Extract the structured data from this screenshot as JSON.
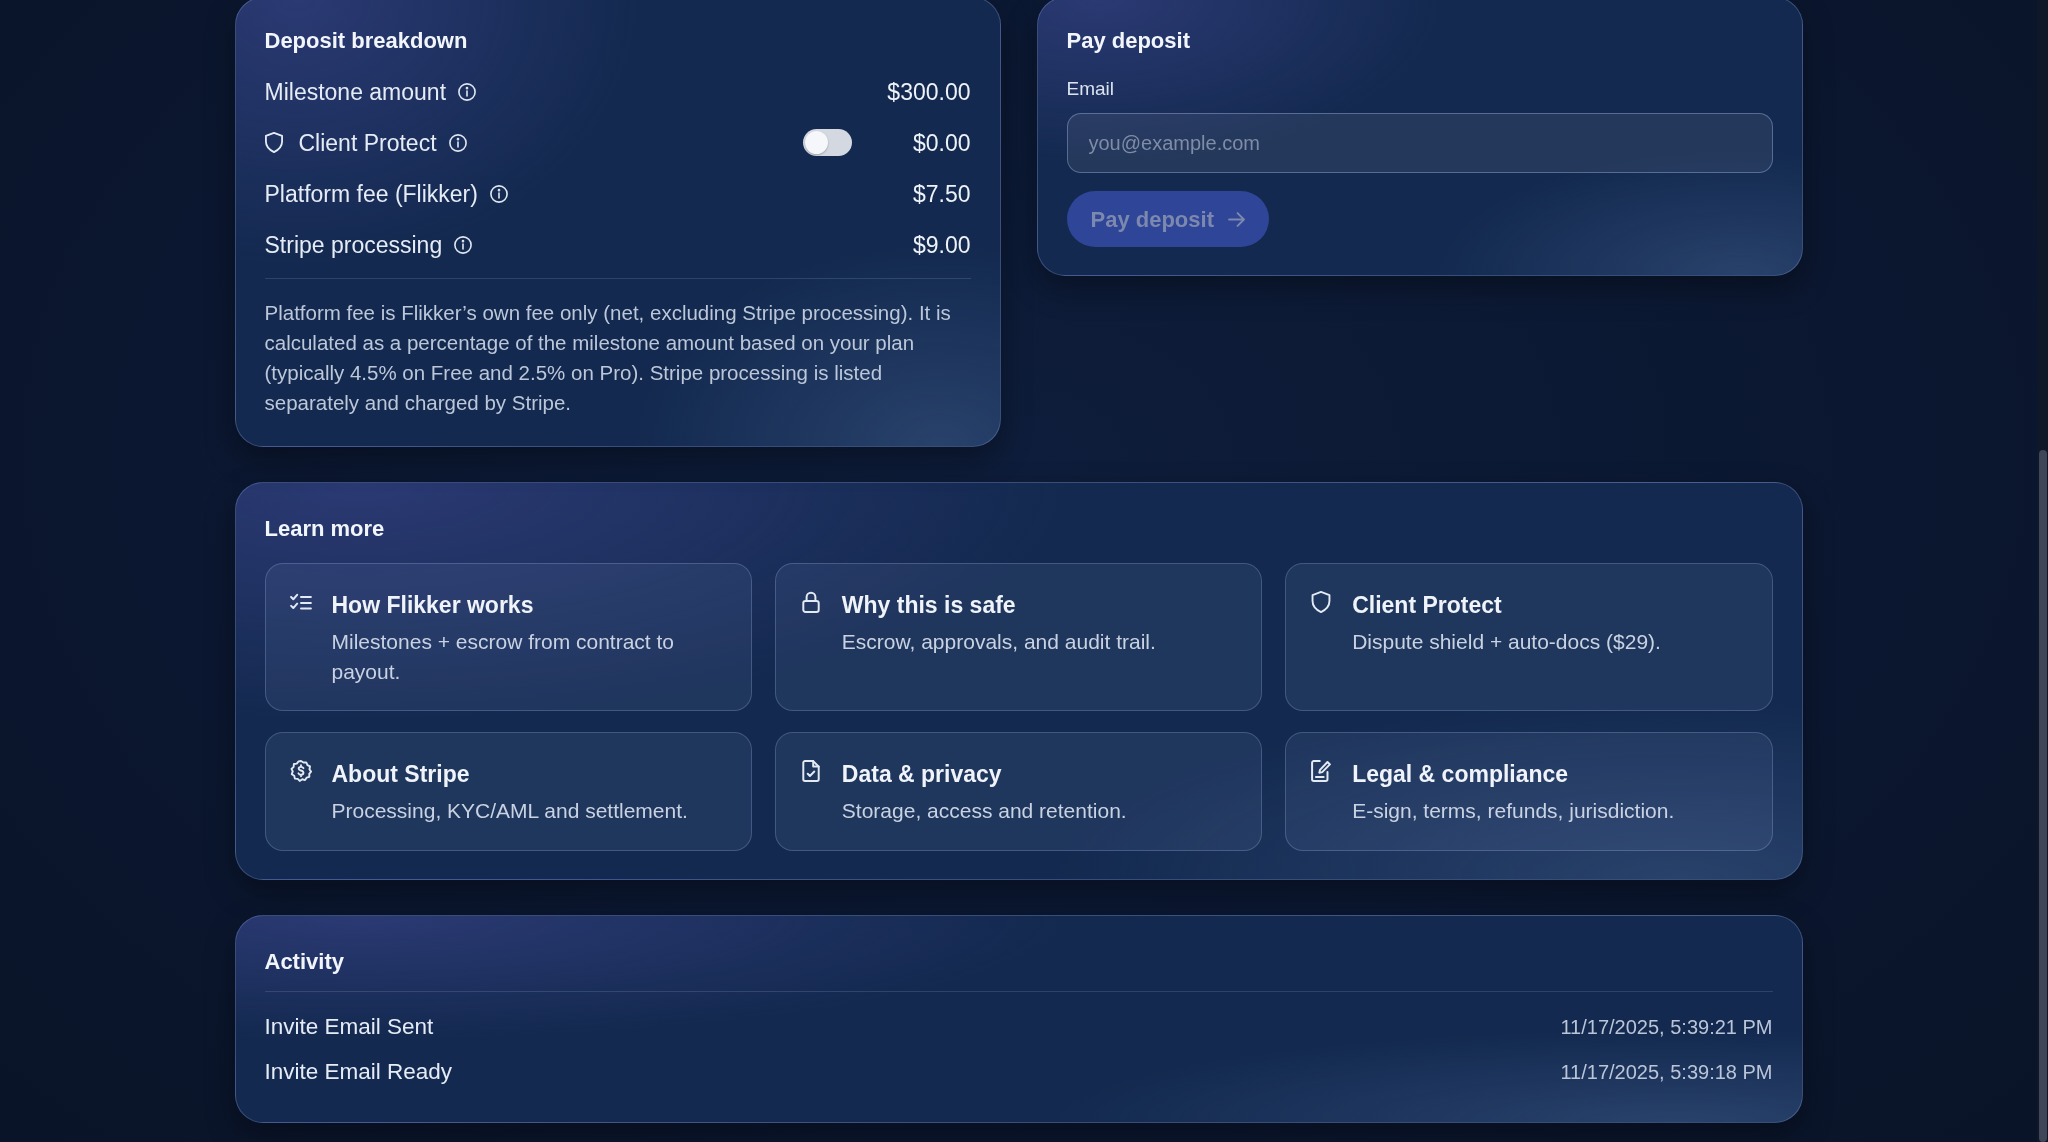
{
  "deposit_breakdown": {
    "title": "Deposit breakdown",
    "rows": [
      {
        "kind": "amount",
        "label": "Milestone amount",
        "amount": "$300.00"
      },
      {
        "kind": "toggle",
        "label": "Client Protect",
        "on": false,
        "amount": "$0.00"
      },
      {
        "kind": "amount",
        "label": "Platform fee (Flikker)",
        "amount": "$7.50"
      },
      {
        "kind": "amount",
        "label": "Stripe processing",
        "amount": "$9.00"
      }
    ],
    "note": "Platform fee is Flikker’s own fee only (net, excluding Stripe processing). It is calculated as a percentage of the milestone amount based on your plan (typically 4.5% on Free and 2.5% on Pro). Stripe processing is listed separately and charged by Stripe."
  },
  "pay_deposit": {
    "title": "Pay deposit",
    "email": {
      "label": "Email",
      "placeholder": "you@example.com"
    },
    "button": {
      "label": "Pay deposit",
      "disabled": true
    }
  },
  "learn_more": {
    "title": "Learn more",
    "items": [
      {
        "title": "How Flikker works",
        "description": "Milestones + escrow from contract to payout."
      },
      {
        "title": "Why this is safe",
        "description": "Escrow, approvals, and audit trail."
      },
      {
        "title": "Client Protect",
        "description": "Dispute shield + auto-docs ($29)."
      },
      {
        "title": "About Stripe",
        "description": "Processing, KYC/AML and settlement."
      },
      {
        "title": "Data & privacy",
        "description": "Storage, access and retention."
      },
      {
        "title": "Legal & compliance",
        "description": "E-sign, terms, refunds, jurisdiction."
      }
    ]
  },
  "activity": {
    "title": "Activity",
    "events": [
      {
        "text": "Invite Email Sent",
        "time": "11/17/2025, 5:39:21 PM"
      },
      {
        "text": "Invite Email Ready",
        "time": "11/17/2025, 5:39:18 PM"
      }
    ]
  }
}
